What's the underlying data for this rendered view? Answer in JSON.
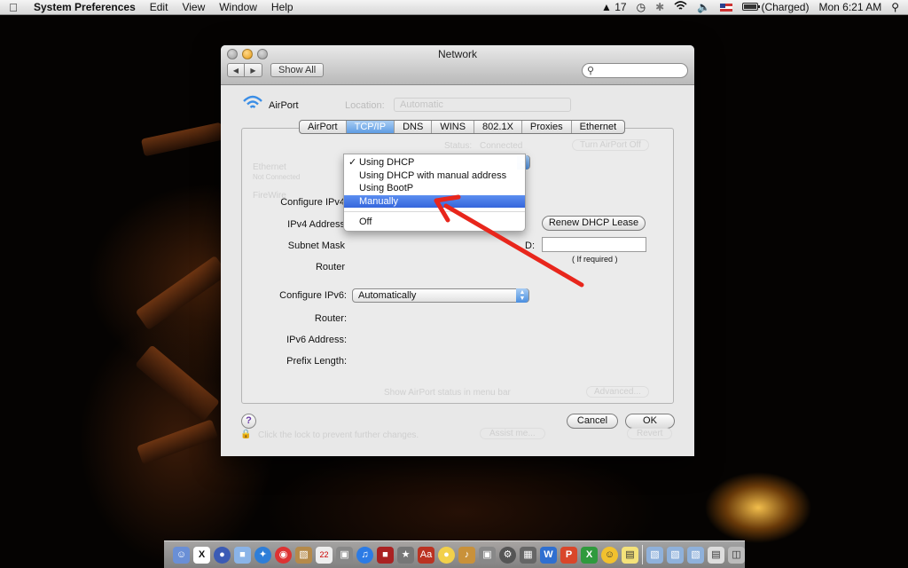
{
  "menubar": {
    "app_name": "System Preferences",
    "menus": [
      "Edit",
      "View",
      "Window",
      "Help"
    ],
    "status": {
      "adobe_count": "17",
      "battery_text": "(Charged)",
      "clock": "Mon 6:21 AM"
    }
  },
  "window": {
    "title": "Network",
    "show_all": "Show All",
    "search_placeholder": "",
    "interface_name": "AirPort",
    "location_label": "Location:",
    "location_value": "Automatic",
    "tabs": [
      "AirPort",
      "TCP/IP",
      "DNS",
      "WINS",
      "802.1X",
      "Proxies",
      "Ethernet"
    ],
    "active_tab": "TCP/IP",
    "form": {
      "configure_ipv4_label": "Configure IPv4",
      "ipv4_address_label": "IPv4 Address",
      "subnet_mask_label": "Subnet Mask",
      "router_label": "Router",
      "renew_button": "Renew DHCP Lease",
      "dhcp_client_id_label": "D:",
      "if_required": "( If required )",
      "configure_ipv6_label": "Configure IPv6:",
      "configure_ipv6_value": "Automatically",
      "router6_label": "Router:",
      "ipv6_address_label": "IPv6 Address:",
      "prefix_length_label": "Prefix Length:"
    },
    "ipv4_menu": {
      "checked_item": "Using DHCP",
      "items": [
        "Using DHCP",
        "Using DHCP with manual address",
        "Using BootP",
        "Manually",
        "Off"
      ],
      "highlighted": "Manually"
    },
    "ghost": {
      "status_label": "Status:",
      "status_value": "Connected",
      "turn_off": "Turn AirPort Off",
      "show_status": "Show AirPort status in menu bar",
      "advanced": "Advanced...",
      "lock_text": "Click the lock to prevent further changes.",
      "assist": "Assist me...",
      "revert": "Revert",
      "sidebar_ethernet": "Ethernet",
      "sidebar_firewire": "FireWire",
      "sidebar_sub": "Not Connected"
    },
    "footer": {
      "help": "?",
      "cancel": "Cancel",
      "ok": "OK"
    }
  },
  "colors": {
    "selection_blue": "#3566dc",
    "annotation_red": "#e8261c",
    "active_tab": "#5e9ce3"
  }
}
